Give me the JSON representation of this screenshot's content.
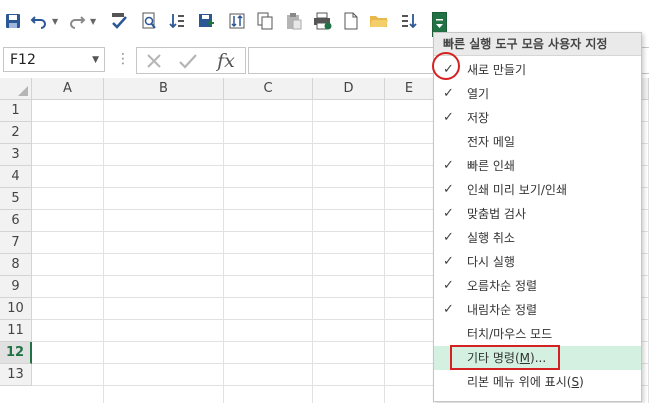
{
  "toolbar": {
    "customize_arrow": "▾"
  },
  "namebox": {
    "value": "F12"
  },
  "formula": {
    "fx": "fx",
    "dots": "⋮"
  },
  "columns": [
    "A",
    "B",
    "C",
    "D",
    "E"
  ],
  "rows": [
    "1",
    "2",
    "3",
    "4",
    "5",
    "6",
    "7",
    "8",
    "9",
    "10",
    "11",
    "12",
    "13"
  ],
  "active_row": "12",
  "menu": {
    "title": "빠른 실행 도구 모음 사용자 지정",
    "items": [
      {
        "label": "새로 만들기",
        "checked": true
      },
      {
        "label": "열기",
        "checked": true
      },
      {
        "label": "저장",
        "checked": true
      },
      {
        "label": "전자 메일",
        "checked": false
      },
      {
        "label": "빠른 인쇄",
        "checked": true
      },
      {
        "label": "인쇄 미리 보기/인쇄",
        "checked": true
      },
      {
        "label": "맞춤법 검사",
        "checked": true
      },
      {
        "label": "실행 취소",
        "checked": true
      },
      {
        "label": "다시 실행",
        "checked": true
      },
      {
        "label": "오름차순 정렬",
        "checked": true
      },
      {
        "label": "내림차순 정렬",
        "checked": true
      },
      {
        "label": "터치/마우스 모드",
        "checked": false
      }
    ],
    "more_commands": {
      "label": "기타 명령(",
      "hotkey": "M",
      "suffix": ")..."
    },
    "show_below": {
      "label": "리본 메뉴 위에 표시(",
      "hotkey": "S",
      "suffix": ")"
    }
  },
  "colors": {
    "accent": "#217346",
    "annotation": "#d42222",
    "highlight": "#d3f0e0"
  }
}
